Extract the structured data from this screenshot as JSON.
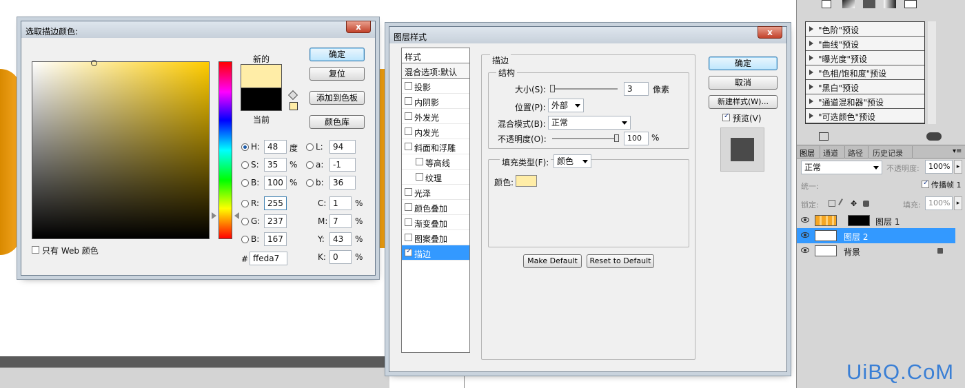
{
  "watermark": "UiBQ.CoM",
  "colorpicker": {
    "title": "选取描边颜色:",
    "close": "x",
    "new_label": "新的",
    "current_label": "当前",
    "ok": "确定",
    "reset": "复位",
    "add_swatch": "添加到色板",
    "libraries": "颜色库",
    "web_only": "只有 Web 颜色",
    "hsb": [
      {
        "k": "H:",
        "v": "48",
        "u": "度"
      },
      {
        "k": "S:",
        "v": "35",
        "u": "%"
      },
      {
        "k": "B:",
        "v": "100",
        "u": "%"
      }
    ],
    "lab": [
      {
        "k": "L:",
        "v": "94"
      },
      {
        "k": "a:",
        "v": "-1"
      },
      {
        "k": "b:",
        "v": "36"
      }
    ],
    "rgb": [
      {
        "k": "R:",
        "v": "255"
      },
      {
        "k": "G:",
        "v": "237"
      },
      {
        "k": "B:",
        "v": "167"
      }
    ],
    "cmyk": [
      {
        "k": "C:",
        "v": "1",
        "u": "%"
      },
      {
        "k": "M:",
        "v": "7",
        "u": "%"
      },
      {
        "k": "Y:",
        "v": "43",
        "u": "%"
      },
      {
        "k": "K:",
        "v": "0",
        "u": "%"
      }
    ],
    "hex_label": "#",
    "hex": "ffeda7",
    "new_color": "#ffeda7",
    "current_color": "#000000"
  },
  "layerstyle": {
    "title": "图层样式",
    "close": "x",
    "styles_header": "样式",
    "blend_default": "混合选项:默认",
    "items": [
      {
        "label": "投影",
        "checked": false,
        "indent": false
      },
      {
        "label": "内阴影",
        "checked": false,
        "indent": false
      },
      {
        "label": "外发光",
        "checked": false,
        "indent": false
      },
      {
        "label": "内发光",
        "checked": false,
        "indent": false
      },
      {
        "label": "斜面和浮雕",
        "checked": false,
        "indent": false
      },
      {
        "label": "等高线",
        "checked": false,
        "indent": true
      },
      {
        "label": "纹理",
        "checked": false,
        "indent": true
      },
      {
        "label": "光泽",
        "checked": false,
        "indent": false
      },
      {
        "label": "颜色叠加",
        "checked": false,
        "indent": false
      },
      {
        "label": "渐变叠加",
        "checked": false,
        "indent": false
      },
      {
        "label": "图案叠加",
        "checked": false,
        "indent": false
      },
      {
        "label": "描边",
        "checked": true,
        "indent": false
      }
    ],
    "section": "描边",
    "structure": "结构",
    "size_label": "大小(S):",
    "size": "3",
    "size_unit": "像素",
    "position_label": "位置(P):",
    "position": "外部",
    "blend_label": "混合模式(B):",
    "blend": "正常",
    "opacity_label": "不透明度(O):",
    "opacity": "100",
    "opacity_unit": "%",
    "fill_type_label": "填充类型(F):",
    "fill_type": "颜色",
    "color_label": "颜色:",
    "stroke_color": "#ffeda7",
    "make_default": "Make Default",
    "reset_default": "Reset to Default",
    "ok": "确定",
    "cancel": "取消",
    "new_style": "新建样式(W)...",
    "preview": "预览(V)"
  },
  "adjustments": {
    "presets": [
      "\"色阶\"预设",
      "\"曲线\"预设",
      "\"曝光度\"预设",
      "\"色相/饱和度\"预设",
      "\"黑白\"预设",
      "\"通道混和器\"预设",
      "\"可选颜色\"预设"
    ]
  },
  "layers": {
    "tabs": [
      "图层",
      "通道",
      "路径",
      "历史记录"
    ],
    "blend": "正常",
    "opacity_label": "不透明度:",
    "opacity": "100%",
    "unify_label": "统一:",
    "propagate": "传播帧 1",
    "lock_label": "锁定:",
    "fill_label": "填充:",
    "fill": "100%",
    "items": [
      {
        "name": "图层 1",
        "selected": false
      },
      {
        "name": "图层 2",
        "selected": true
      },
      {
        "name": "背景",
        "selected": false
      }
    ]
  }
}
